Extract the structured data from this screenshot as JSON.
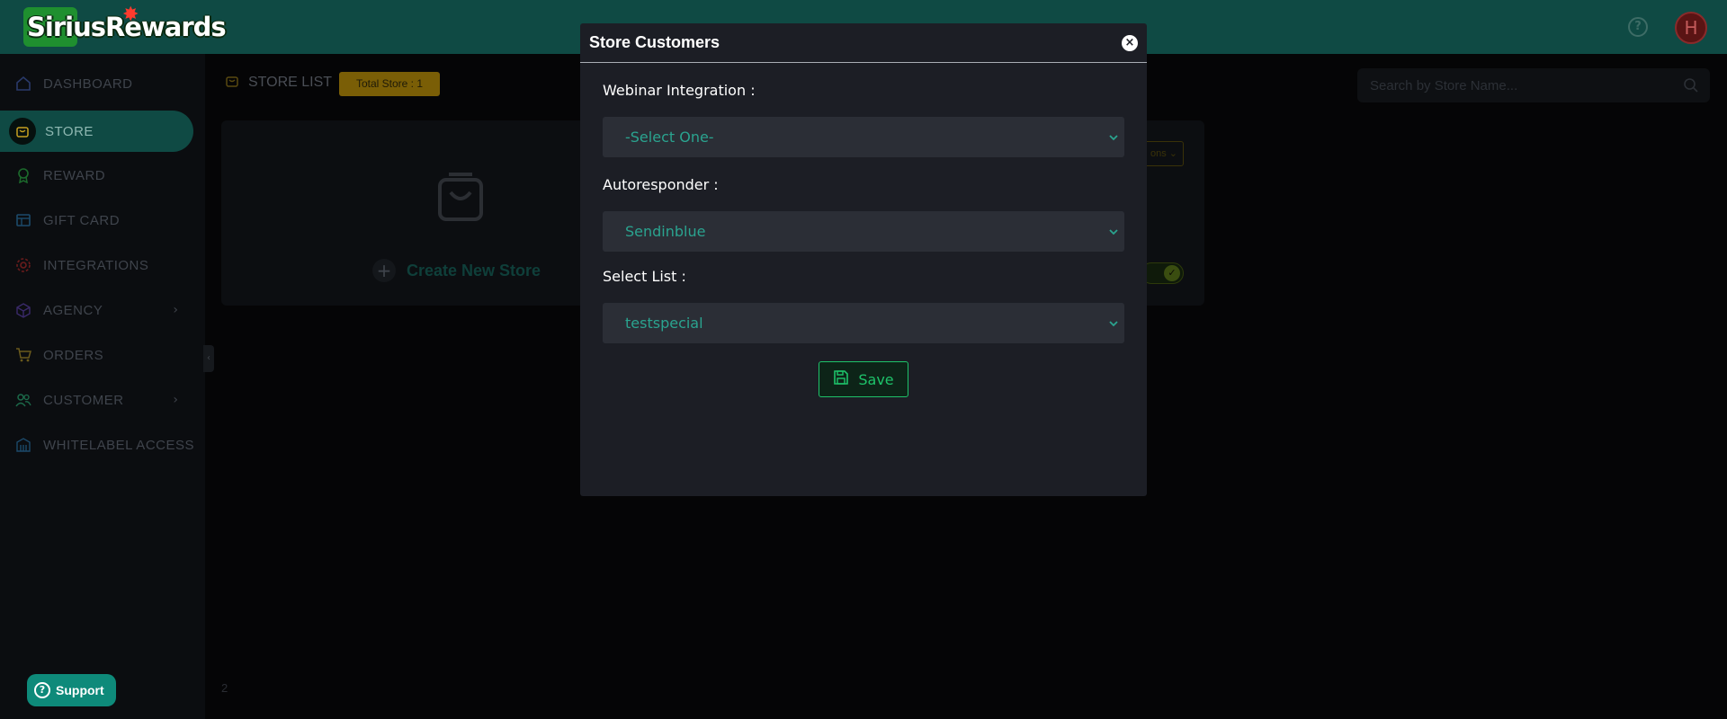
{
  "header": {
    "brand": "SiriusRewards",
    "help_icon": "?",
    "avatar_initial": "H"
  },
  "sidebar": {
    "items": [
      {
        "label": "DASHBOARD",
        "icon": "home-icon"
      },
      {
        "label": "STORE",
        "icon": "bag-icon",
        "active": true
      },
      {
        "label": "REWARD",
        "icon": "award-icon"
      },
      {
        "label": "GIFT CARD",
        "icon": "card-icon"
      },
      {
        "label": "INTEGRATIONS",
        "icon": "gear-icon"
      },
      {
        "label": "AGENCY",
        "icon": "cube-icon",
        "chevron": "›"
      },
      {
        "label": "ORDERS",
        "icon": "cart-icon"
      },
      {
        "label": "CUSTOMER",
        "icon": "users-icon",
        "chevron": "›"
      },
      {
        "label": "WHITELABEL ACCESS",
        "icon": "building-icon"
      }
    ],
    "collapse_glyph": "‹"
  },
  "main": {
    "title": "STORE LIST",
    "total_badge": "Total Store : 1",
    "search_placeholder": "Search by Store Name...",
    "create_store_label": "Create New Store",
    "actions_partial": "ons",
    "page_indicator": "2"
  },
  "support": {
    "label": "Support"
  },
  "modal": {
    "title": "Store Customers",
    "fields": [
      {
        "label": "Webinar Integration :",
        "value": "-Select One-"
      },
      {
        "label": "Autoresponder :",
        "value": "Sendinblue"
      },
      {
        "label": "Select List :",
        "value": "testspecial"
      }
    ],
    "save_label": "Save"
  },
  "colors": {
    "accent": "#0f4a44",
    "modal_bg": "#1c1e25",
    "select_text": "#2aa38f",
    "save_green": "#1ec36a",
    "badge_gold": "#7a5e06"
  }
}
